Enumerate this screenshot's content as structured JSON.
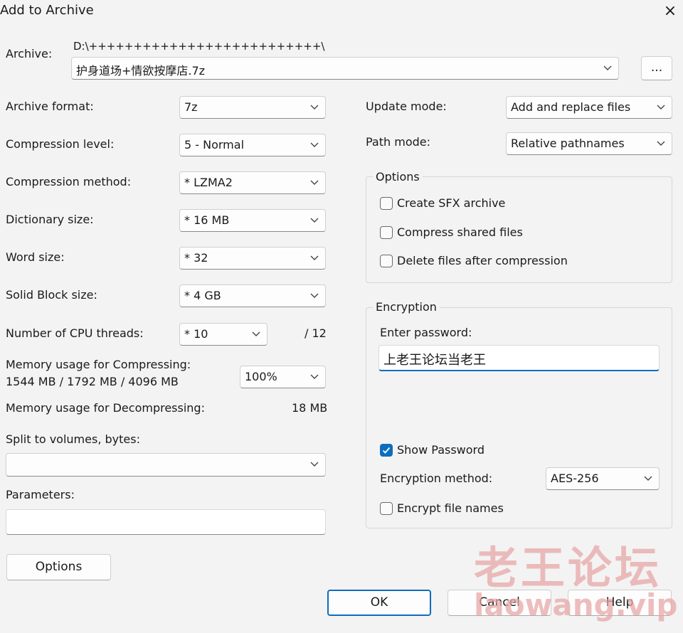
{
  "window": {
    "title": "Add to Archive",
    "close_icon": "×"
  },
  "archive": {
    "label": "Archive:",
    "path": "D:\\++++++++++++++++++++++++++\\",
    "filename": "护身道场+情欲按摩店.7z",
    "browse_label": "..."
  },
  "left": {
    "archive_format": {
      "label": "Archive format:",
      "value": "7z"
    },
    "compression_level": {
      "label": "Compression level:",
      "value": "5 - Normal"
    },
    "compression_method": {
      "label": "Compression method:",
      "value": "*  LZMA2"
    },
    "dictionary_size": {
      "label": "Dictionary size:",
      "value": "*  16 MB"
    },
    "word_size": {
      "label": "Word size:",
      "value": "*  32"
    },
    "solid_block_size": {
      "label": "Solid Block size:",
      "value": "*  4 GB"
    },
    "cpu_threads": {
      "label": "Number of CPU threads:",
      "value": "*  10",
      "max": "/ 12"
    },
    "memory_compress": {
      "label": "Memory usage for Compressing:",
      "detail": "1544 MB / 1792 MB / 4096 MB",
      "value": "100%"
    },
    "memory_decompress": {
      "label": "Memory usage for Decompressing:",
      "value": "18 MB"
    },
    "split_volumes": {
      "label": "Split to volumes, bytes:",
      "value": ""
    },
    "parameters": {
      "label": "Parameters:",
      "value": ""
    },
    "options_button": "Options"
  },
  "right": {
    "update_mode": {
      "label": "Update mode:",
      "value": "Add and replace files"
    },
    "path_mode": {
      "label": "Path mode:",
      "value": "Relative pathnames"
    },
    "options_group": {
      "legend": "Options",
      "items": [
        {
          "label": "Create SFX archive",
          "checked": false
        },
        {
          "label": "Compress shared files",
          "checked": false
        },
        {
          "label": "Delete files after compression",
          "checked": false
        }
      ]
    },
    "encryption": {
      "legend": "Encryption",
      "enter_password_label": "Enter password:",
      "password_value": "上老王论坛当老王",
      "show_password": {
        "label": "Show Password",
        "checked": true
      },
      "method_label": "Encryption method:",
      "method_value": "AES-256",
      "encrypt_names": {
        "label": "Encrypt file names",
        "checked": false
      }
    }
  },
  "footer": {
    "ok": "OK",
    "cancel": "Cancel",
    "help": "Help"
  },
  "watermark": {
    "line1": "老王论坛",
    "line2": "laowang.vip"
  },
  "colors": {
    "accent": "#0f6cbd",
    "background": "#f3f3f3",
    "watermark": "#e8a8a8"
  }
}
